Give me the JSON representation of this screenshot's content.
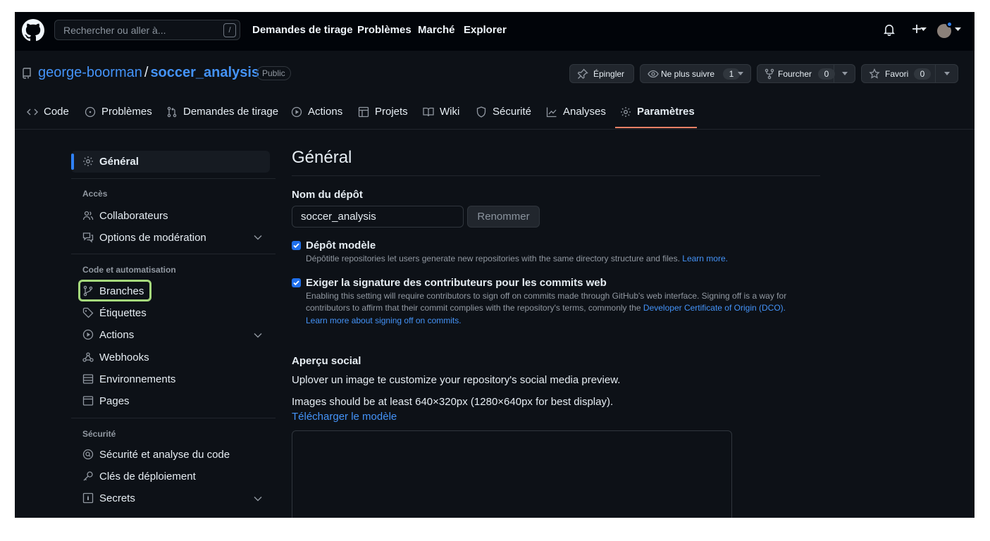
{
  "topbar": {
    "search_placeholder": "Rechercher ou aller à...",
    "search_shortcut": "/",
    "nav": [
      "Demandes de tirage",
      "Problèmes",
      "Marché",
      "Explorer"
    ]
  },
  "repo": {
    "owner": "george-boorman",
    "separator": "/",
    "name": "soccer_analysis",
    "visibility": "Public",
    "pin_label": "Épingler",
    "watch_label": "Ne plus suivre",
    "watch_count": "1",
    "fork_label": "Fourcher",
    "fork_count": "0",
    "star_label": "Favori",
    "star_count": "0"
  },
  "repo_nav": {
    "tabs": [
      "Code",
      "Problèmes",
      "Demandes de tirage",
      "Actions",
      "Projets",
      "Wiki",
      "Sécurité",
      "Analyses",
      "Paramètres"
    ],
    "active": "Paramètres"
  },
  "sidebar": {
    "general": "Général",
    "section_access": "Accès",
    "collaborators": "Collaborateurs",
    "moderation": "Options de modération",
    "section_code": "Code et automatisation",
    "branches": "Branches",
    "tags": "Étiquettes",
    "actions": "Actions",
    "webhooks": "Webhooks",
    "environments": "Environnements",
    "pages": "Pages",
    "section_security": "Sécurité",
    "code_security": "Sécurité et analyse du code",
    "deploy_keys": "Clés de déploiement",
    "secrets": "Secrets"
  },
  "main": {
    "title": "Général",
    "repo_name_label": "Nom du dépôt",
    "repo_name_value": "soccer_analysis",
    "rename_button": "Renommer",
    "template_checked": true,
    "template_label": "Dépôt modèle",
    "template_desc": "Dépôtitle repositories let users generate new repositories with the same directory structure and files.",
    "template_learn_more": "Learn more.",
    "signoff_checked": true,
    "signoff_label": "Exiger la signature des contributeurs pour les commits web",
    "signoff_desc_1": "Enabling this setting will require contributors to sign off on commits made through GitHub's web interface. Signing off is a way for",
    "signoff_desc_2": "contributors to affirm that their commit complies with the repository's terms, commonly the",
    "signoff_dco_link": "Developer Certificate of Origin (DCO).",
    "signoff_learn_link": "Learn more about signing off on commits.",
    "social_title": "Aperçu social",
    "social_desc": "Uplover un image te customize your repository's social media preview.",
    "social_size": "Images should be at least 640×320px (1280×640px for best display).",
    "social_template_link": "Télécharger le modèle"
  },
  "colors": {
    "background": "#0d1117",
    "topbar": "#010409",
    "link": "#4493f8",
    "active_tab_underline": "#f78166",
    "checkbox": "#1f6feb",
    "highlight_outline": "#a5d87c"
  }
}
